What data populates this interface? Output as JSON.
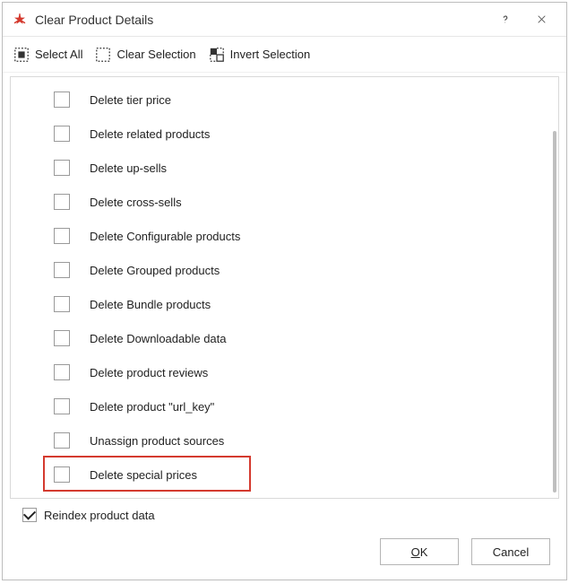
{
  "titlebar": {
    "title": "Clear Product Details"
  },
  "toolbar": {
    "select_all": "Select All",
    "clear_selection": "Clear Selection",
    "invert_selection": "Invert Selection"
  },
  "options": [
    {
      "label": "Delete tier price",
      "checked": false,
      "highlight": false
    },
    {
      "label": "Delete related products",
      "checked": false,
      "highlight": false
    },
    {
      "label": "Delete up-sells",
      "checked": false,
      "highlight": false
    },
    {
      "label": "Delete cross-sells",
      "checked": false,
      "highlight": false
    },
    {
      "label": "Delete Configurable products",
      "checked": false,
      "highlight": false
    },
    {
      "label": "Delete Grouped products",
      "checked": false,
      "highlight": false
    },
    {
      "label": "Delete Bundle products",
      "checked": false,
      "highlight": false
    },
    {
      "label": "Delete Downloadable data",
      "checked": false,
      "highlight": false
    },
    {
      "label": "Delete product reviews",
      "checked": false,
      "highlight": false
    },
    {
      "label": "Delete product \"url_key\"",
      "checked": false,
      "highlight": false
    },
    {
      "label": "Unassign product sources",
      "checked": false,
      "highlight": false
    },
    {
      "label": "Delete special prices",
      "checked": false,
      "highlight": true
    }
  ],
  "reindex": {
    "label": "Reindex product data",
    "checked": true
  },
  "buttons": {
    "ok_pre": "",
    "ok_accel": "O",
    "ok_post": "K",
    "cancel": "Cancel"
  }
}
